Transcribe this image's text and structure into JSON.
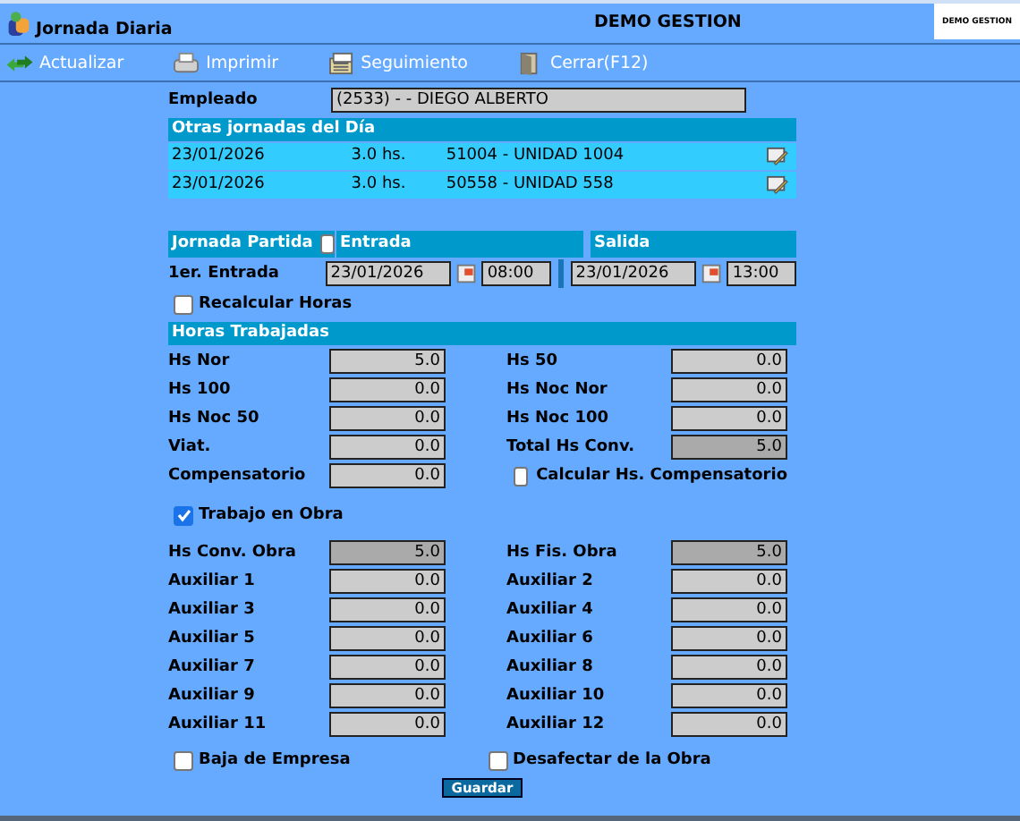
{
  "header": {
    "title": "Jornada Diaria",
    "company": "DEMO GESTION",
    "logo_text": "DEMO GESTION"
  },
  "toolbar": [
    {
      "label": "Actualizar",
      "kind": "refresh"
    },
    {
      "label": "Imprimir",
      "kind": "print"
    },
    {
      "label": "Seguimiento",
      "kind": "track"
    },
    {
      "label": "Cerrar(F12)",
      "kind": "close"
    }
  ],
  "employee": {
    "label": "Empleado",
    "value": "(2533) - - DIEGO ALBERTO"
  },
  "other_days": {
    "title": "Otras jornadas del Día",
    "rows": [
      {
        "date": "23/01/2026",
        "hours": "3.0 hs.",
        "unit": "51004 - UNIDAD 1004"
      },
      {
        "date": "23/01/2026",
        "hours": "3.0 hs.",
        "unit": "50558 - UNIDAD 558"
      }
    ]
  },
  "shift": {
    "split_label": "Jornada Partida",
    "split_checked": false,
    "entry_header": "Entrada",
    "exit_header": "Salida",
    "row_label": "1er. Entrada",
    "entry_date": "23/01/2026",
    "entry_time": "08:00",
    "exit_date": "23/01/2026",
    "exit_time": "13:00"
  },
  "recalc": {
    "label": "Recalcular Horas",
    "checked": false
  },
  "hours": {
    "title": "Horas Trabajadas",
    "fields": [
      {
        "kind": "field",
        "label": "Hs Nor",
        "value": "5.0"
      },
      {
        "kind": "field",
        "label": "Hs 50",
        "value": "0.0"
      },
      {
        "kind": "field",
        "label": "Hs 100",
        "value": "0.0"
      },
      {
        "kind": "field",
        "label": "Hs Noc Nor",
        "value": "0.0"
      },
      {
        "kind": "field",
        "label": "Hs Noc 50",
        "value": "0.0"
      },
      {
        "kind": "field",
        "label": "Hs Noc 100",
        "value": "0.0"
      },
      {
        "kind": "field",
        "label": "Viat.",
        "value": "0.0"
      },
      {
        "kind": "total",
        "label": "Total Hs Conv.",
        "value": "5.0"
      },
      {
        "kind": "field",
        "label": "Compensatorio",
        "value": "0.0"
      },
      {
        "kind": "check",
        "label": "Calcular Hs. Compensatorio",
        "checked": false
      }
    ]
  },
  "obra": {
    "label": "Trabajo en Obra",
    "checked": true,
    "fields": [
      {
        "kind": "total",
        "label": "Hs Conv. Obra",
        "value": "5.0"
      },
      {
        "kind": "total",
        "label": "Hs Fis. Obra",
        "value": "5.0"
      },
      {
        "kind": "field",
        "label": "Auxiliar 1",
        "value": "0.0"
      },
      {
        "kind": "field",
        "label": "Auxiliar 2",
        "value": "0.0"
      },
      {
        "kind": "field",
        "label": "Auxiliar 3",
        "value": "0.0"
      },
      {
        "kind": "field",
        "label": "Auxiliar 4",
        "value": "0.0"
      },
      {
        "kind": "field",
        "label": "Auxiliar 5",
        "value": "0.0"
      },
      {
        "kind": "field",
        "label": "Auxiliar 6",
        "value": "0.0"
      },
      {
        "kind": "field",
        "label": "Auxiliar 7",
        "value": "0.0"
      },
      {
        "kind": "field",
        "label": "Auxiliar 8",
        "value": "0.0"
      },
      {
        "kind": "field",
        "label": "Auxiliar 9",
        "value": "0.0"
      },
      {
        "kind": "field",
        "label": "Auxiliar 10",
        "value": "0.0"
      },
      {
        "kind": "field",
        "label": "Auxiliar 11",
        "value": "0.0"
      },
      {
        "kind": "field",
        "label": "Auxiliar 12",
        "value": "0.0"
      }
    ]
  },
  "bottom_checks": [
    {
      "label": "Baja de Empresa",
      "checked": false
    },
    {
      "label": "Desafectar de la Obra",
      "checked": false
    }
  ],
  "save_button": "Guardar"
}
